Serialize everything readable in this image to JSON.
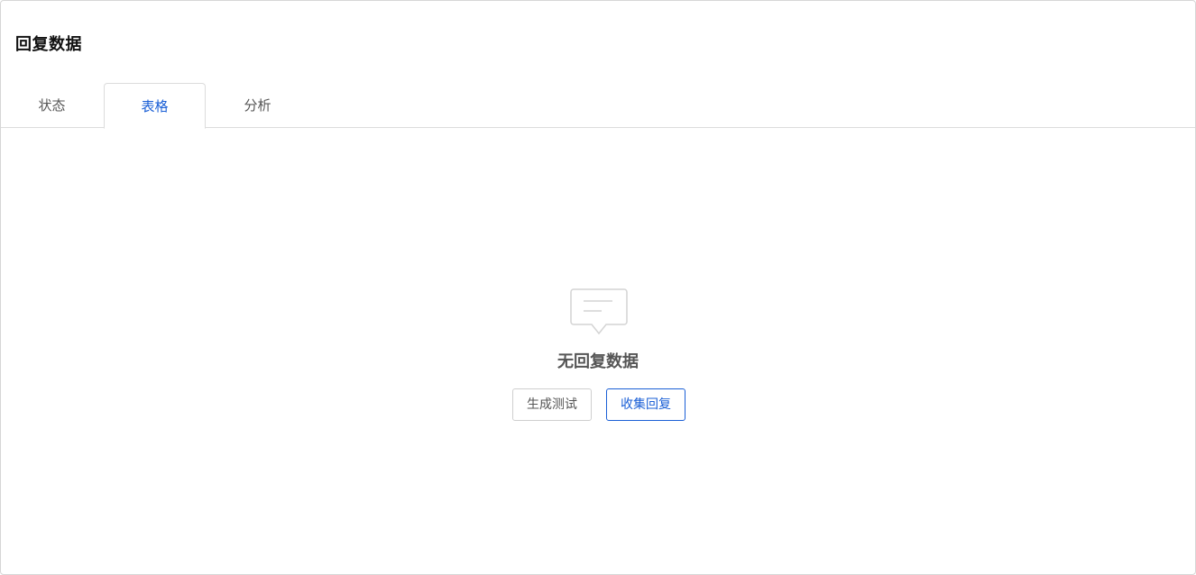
{
  "header": {
    "title": "回复数据"
  },
  "tabs": [
    {
      "label": "状态",
      "active": false
    },
    {
      "label": "表格",
      "active": true
    },
    {
      "label": "分析",
      "active": false
    }
  ],
  "empty_state": {
    "icon": "message-bubble-icon",
    "title": "无回复数据",
    "actions": {
      "generate_test_label": "生成测试",
      "collect_responses_label": "收集回复"
    }
  },
  "colors": {
    "accent": "#1a5fd6",
    "border": "#dcdcdc",
    "text_muted": "#555555"
  }
}
